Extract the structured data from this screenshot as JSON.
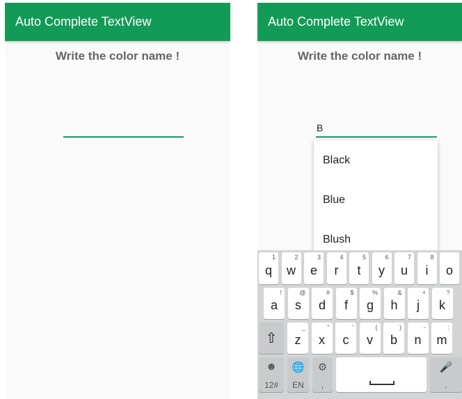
{
  "left_screen": {
    "app_title": "Auto Complete TextView",
    "heading": "Write the color name !",
    "input_value": ""
  },
  "right_screen": {
    "app_title": "Auto Complete TextView",
    "heading": "Write the color name !",
    "input_value": "B",
    "suggestions": [
      "Black",
      "Blue",
      "Blush"
    ]
  },
  "colors": {
    "app_bar": "#129b56",
    "underline": "#1a9a63",
    "heading_text": "#656565"
  },
  "keyboard": {
    "row1": [
      {
        "key": "q",
        "hint": "1"
      },
      {
        "key": "w",
        "hint": "2"
      },
      {
        "key": "e",
        "hint": "3"
      },
      {
        "key": "r",
        "hint": "4"
      },
      {
        "key": "t",
        "hint": "5"
      },
      {
        "key": "y",
        "hint": "6"
      },
      {
        "key": "u",
        "hint": "7"
      },
      {
        "key": "i",
        "hint": "8"
      },
      {
        "key": "o",
        "hint": ""
      }
    ],
    "row2": [
      {
        "key": "a",
        "hint": "!"
      },
      {
        "key": "s",
        "hint": "@"
      },
      {
        "key": "d",
        "hint": "#"
      },
      {
        "key": "f",
        "hint": "$"
      },
      {
        "key": "g",
        "hint": "%"
      },
      {
        "key": "h",
        "hint": "&"
      },
      {
        "key": "j",
        "hint": "+"
      },
      {
        "key": "k",
        "hint": "?"
      }
    ],
    "row3": [
      {
        "key": "z",
        "hint": "_"
      },
      {
        "key": "x",
        "hint": "\""
      },
      {
        "key": "c",
        "hint": "'"
      },
      {
        "key": "v",
        "hint": "("
      },
      {
        "key": "b",
        "hint": ")"
      },
      {
        "key": "n",
        "hint": "-"
      },
      {
        "key": "m",
        "hint": ":"
      }
    ],
    "shift_icon": "shift-arrow-icon",
    "emoji_icon": "emoji-icon",
    "numbers_label": "12#",
    "globe_icon": "globe-icon",
    "language_label": "EN",
    "settings_icon": "gear-icon",
    "comma_label": ",",
    "mic_icon": "microphone-icon",
    "period_label": "."
  }
}
